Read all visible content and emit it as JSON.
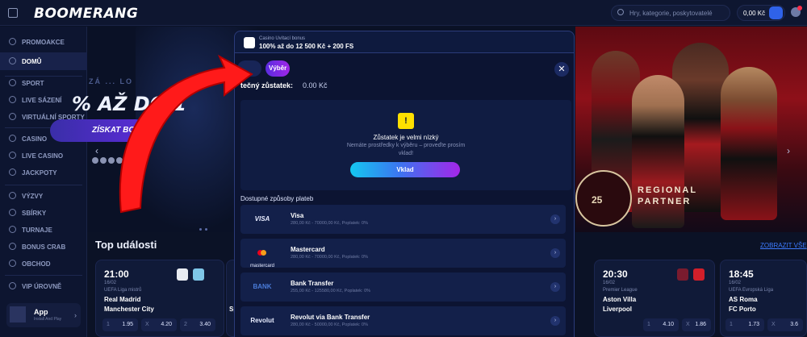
{
  "header": {
    "logo": "BOOMERANG",
    "search_placeholder": "Hry, kategorie, poskytovatelé",
    "balance": "0,00 Kč"
  },
  "sidebar": {
    "items": [
      {
        "label": "PROMOAKCE",
        "icon": "gift-icon"
      },
      {
        "label": "DOMŮ",
        "icon": "home-icon",
        "active": true
      },
      {
        "label": "SPORT",
        "icon": "ball-icon"
      },
      {
        "label": "LIVE SÁZENÍ",
        "icon": "live-icon"
      },
      {
        "label": "VIRTUÁLNÍ SPORTY",
        "icon": "virtual-icon"
      },
      {
        "label": "CASINO",
        "icon": "casino-icon"
      },
      {
        "label": "LIVE CASINO",
        "icon": "live-casino-icon"
      },
      {
        "label": "JACKPOTY",
        "icon": "jackpot-icon"
      },
      {
        "label": "VÝZVY",
        "icon": "challenge-icon"
      },
      {
        "label": "SBÍRKY",
        "icon": "collection-icon"
      },
      {
        "label": "TURNAJE",
        "icon": "trophy-icon"
      },
      {
        "label": "BONUS CRAB",
        "icon": "crab-icon"
      },
      {
        "label": "OBCHOD",
        "icon": "shop-icon"
      },
      {
        "label": "VIP ÚROVNĚ",
        "icon": "vip-icon"
      }
    ],
    "app_label": "App",
    "app_sub": "Install And Play"
  },
  "hero": {
    "small_text": "ZÁ ... LO",
    "big_text": "% AŽ DO 1",
    "cta": "ZÍSKAT BONU",
    "regional_line1": "REGIONAL",
    "regional_line2": "PARTNER",
    "badge": "25"
  },
  "events": {
    "title": "Top události",
    "see_all": "ZOBRAZIT VŠE",
    "cards": [
      {
        "time": "21:00",
        "date": "16/02",
        "league": "UEFA Liga mistrů",
        "team1": "Real Madrid",
        "team2": "Manchester City",
        "odds": [
          {
            "k": "1",
            "v": "1.95"
          },
          {
            "k": "X",
            "v": "4.20"
          },
          {
            "k": "2",
            "v": "3.40"
          }
        ]
      },
      {
        "time": "20:30",
        "date": "16/02",
        "league": "Premier League",
        "team1": "Aston Villa",
        "team2": "Liverpool",
        "odds": [
          {
            "k": "1",
            "v": "4.10"
          },
          {
            "k": "X",
            "v": "1.86"
          }
        ]
      },
      {
        "time": "18:45",
        "date": "16/02",
        "league": "UEFA Evropská Liga",
        "team1": "AS Roma",
        "team2": "FC Porto",
        "odds": [
          {
            "k": "1",
            "v": "1.73"
          },
          {
            "k": "X",
            "v": "3.6"
          }
        ]
      }
    ],
    "partial_team": "Sp"
  },
  "promo": {
    "small": "Casino Uvítací bonus",
    "big": "100% až do 12 500 Kč + 200 FS"
  },
  "modal": {
    "tab_withdraw": "Výběr",
    "close": "✕",
    "balance_label": "tečný zůstatek:",
    "balance_value": "0.00 Kč",
    "info_icon": "!",
    "info_title": "Zůstatek je velmi nízký",
    "info_sub": "Nemáte prostředky k výběru – proveďte prosím vklad!",
    "deposit_button": "Vklad",
    "methods_title": "Dostupné způsoby plateb",
    "methods": [
      {
        "logo": "VISA",
        "name": "Visa",
        "desc": "280,00 Kč - 70000,00 Kč, Poplatek: 0%"
      },
      {
        "logo": "mastercard",
        "name": "Mastercard",
        "desc": "280,00 Kč - 70000,00 Kč, Poplatek: 0%"
      },
      {
        "logo": "BANK",
        "name": "Bank Transfer",
        "desc": "255,00 Kč - 125580,00 Kč, Poplatek: 0%"
      },
      {
        "logo": "Revolut",
        "name": "Revolut via Bank Transfer",
        "desc": "280,00 Kč - 50000,00 Kč, Poplatek: 0%"
      }
    ]
  },
  "colors": {
    "background": "#0b1226",
    "accent_gradient_start": "#14c8f0",
    "accent_gradient_end": "#a426e8",
    "arrow": "#ff1a1a"
  }
}
